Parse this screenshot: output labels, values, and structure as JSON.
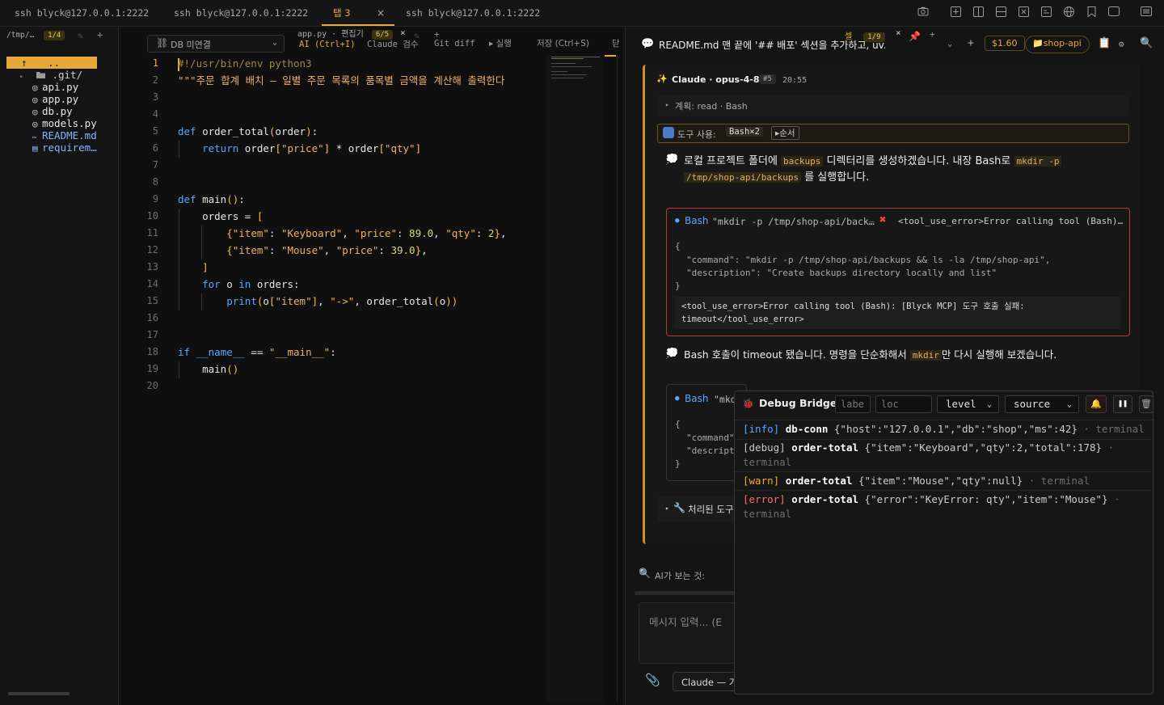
{
  "top_tabs": [
    {
      "label": "ssh blyck@127.0.0.1:2222"
    },
    {
      "label": "ssh blyck@127.0.0.1:2222"
    },
    {
      "label": "탭 3",
      "close": "×"
    },
    {
      "label": "ssh blyck@127.0.0.1:2222"
    }
  ],
  "files": {
    "path": "/tmp/…",
    "page": "1/4",
    "up": "..",
    "items": [
      {
        "icon": "folder",
        "name": ".git/"
      },
      {
        "icon": "python",
        "name": "api.py"
      },
      {
        "icon": "python",
        "name": "app.py"
      },
      {
        "icon": "python",
        "name": "db.py"
      },
      {
        "icon": "python",
        "name": "models.py"
      },
      {
        "icon": "markdown",
        "name": "README.md"
      },
      {
        "icon": "file",
        "name": "requirem…"
      }
    ]
  },
  "editor": {
    "db_status": "DB 미연결",
    "tab_label": "app.py · 편집기",
    "tab_badge": "6/5",
    "close": "×",
    "ai_label": "AI (Ctrl+I)",
    "claude_label": "Claude 검수",
    "diff_label": "Git diff",
    "run_label": "▸ 실행",
    "save_label": "저장 (Ctrl+S)",
    "close_label": "닫",
    "current_line": 1,
    "lines": [
      "#!/usr/bin/env python3",
      "\"\"\"주문 합계 배치 — 일별 주문 목록의 품목별 금액을 계산해 출력한다",
      "",
      "",
      "def order_total(order):",
      "    return order[\"price\"] * order[\"qty\"]",
      "",
      "",
      "def main():",
      "    orders = [",
      "        {\"item\": \"Keyboard\", \"price\": 89.0, \"qty\": 2},",
      "        {\"item\": \"Mouse\", \"price\": 39.0},",
      "    ]",
      "    for o in orders:",
      "        print(o[\"item\"], \"->\", order_total(o))",
      "",
      "",
      "if __name__ == \"__main__\":",
      "    main()",
      ""
    ]
  },
  "chat": {
    "session_badge_label": "셀",
    "session_badge": "1/9",
    "close": "×",
    "plus": "+",
    "title": "README.md 맨 끝에 '## 배포' 섹션을 추가하고, uv.com",
    "cost": "$1.60",
    "project": "shop-api",
    "header": {
      "agent": "Claude",
      "model": "opus-4-8",
      "num": "#5",
      "time": "20:55"
    },
    "plan": "계획: read · Bash",
    "tools_used_label": "도구 사용:",
    "tools_used_value": "Bash×2",
    "order_btn": "▸순서",
    "msg1_a": "로컬 프로젝트 폴더에 ",
    "msg1_code1": "backups",
    "msg1_b": " 디렉터리를 생성하겠습니다. 내장 Bash로 ",
    "msg1_code2": "mkdir -p",
    "msg1_code3": "/tmp/shop-api/backups",
    "msg1_c": " 를 실행합니다.",
    "tool1": {
      "name": "Bash",
      "cmd": "\"mkdir -p /tmp/shop-api/back…",
      "dash": "—",
      "error_short": "<tool_use_error>Error calling tool (Bash)…",
      "json_open": "{",
      "json_cmd": "\"command\": \"mkdir -p /tmp/shop-api/backups && ls -la /tmp/shop-api\",",
      "json_desc": "\"description\": \"Create backups directory locally and list\"",
      "json_close": "}",
      "error_full_1": "<tool_use_error>Error calling tool (Bash): [Blyck MCP] 도구 호출 실패:",
      "error_full_2": "timeout</tool_use_error>"
    },
    "msg2_a": "Bash 호출이 timeout 됐습니다. 명령을 단순화해서 ",
    "msg2_code": "mkdir",
    "msg2_b": "만 다시 실행해 보겠습니다.",
    "tool2": {
      "name": "Bash",
      "cmd": "\"mkd",
      "json_open": "{",
      "json_cmd": "\"command\"",
      "json_desc": "\"descript",
      "json_close": "}"
    },
    "processed_tools": "처리된 도구",
    "ai_sees": "AI가 보는 것:",
    "input_placeholder": "메시지 입력... (E",
    "model_select": "Claude — 가"
  },
  "debug": {
    "title": "Debug Bridge",
    "label_placeholder": "labe",
    "loc_placeholder": "loc",
    "level": "level",
    "source": "source",
    "logs": [
      {
        "level": "[info]",
        "label": "db-conn",
        "json": "{\"host\":\"127.0.0.1\",\"db\":\"shop\",\"ms\":42}",
        "src": "· terminal"
      },
      {
        "level": "[debug]",
        "label": "order-total",
        "json": "{\"item\":\"Keyboard\",\"qty\":2,\"total\":178}",
        "src": "· terminal"
      },
      {
        "level": "[warn]",
        "label": "order-total",
        "json": "{\"item\":\"Mouse\",\"qty\":null}",
        "src": "· terminal"
      },
      {
        "level": "[error]",
        "label": "order-total",
        "json": "{\"error\":\"KeyError: qty\",\"item\":\"Mouse\"}",
        "src": "· terminal"
      }
    ]
  },
  "colors": {
    "accent": "#e8a838",
    "error": "#ff6b6b",
    "info": "#5aa7ff",
    "warn": "#f0b030"
  }
}
